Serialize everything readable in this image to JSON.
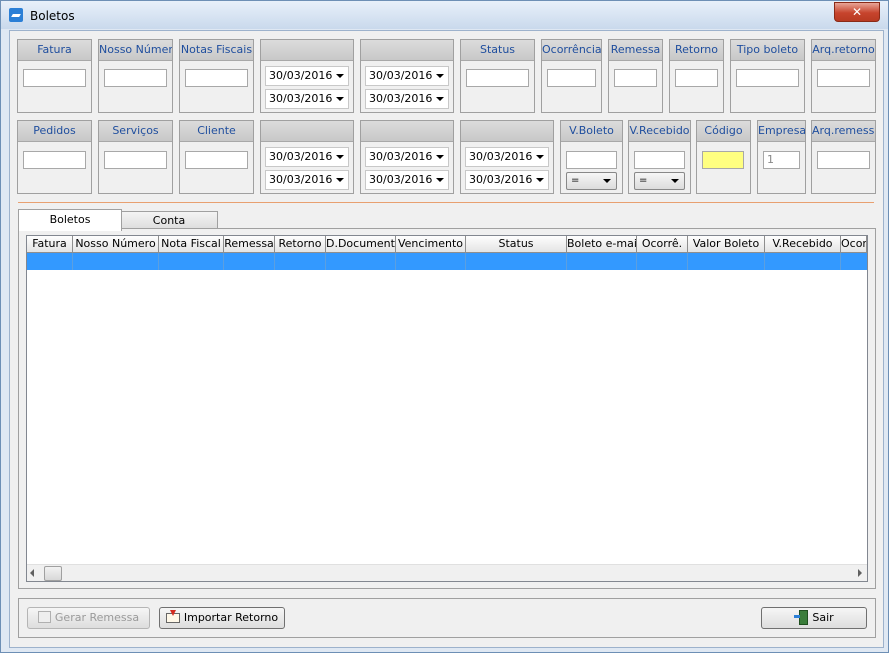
{
  "window": {
    "title": "Boletos",
    "close_label": "✕"
  },
  "filters_row1": {
    "fatura": {
      "label": "Fatura",
      "value": ""
    },
    "nosso_numero": {
      "label": "Nosso Número",
      "value": ""
    },
    "notas_fiscais": {
      "label": "Notas Fiscais",
      "value": ""
    },
    "date_group_1": {
      "label": "",
      "from": "30/03/2016",
      "to": "30/03/2016"
    },
    "date_group_2": {
      "label": "",
      "from": "30/03/2016",
      "to": "30/03/2016"
    },
    "status": {
      "label": "Status",
      "value": ""
    },
    "ocorrencia": {
      "label": "Ocorrência",
      "value": ""
    },
    "remessa": {
      "label": "Remessa",
      "value": ""
    },
    "retorno": {
      "label": "Retorno",
      "value": ""
    },
    "tipo_boleto": {
      "label": "Tipo boleto",
      "value": ""
    },
    "arq_retorno": {
      "label": "Arq.retorno",
      "value": ""
    }
  },
  "filters_row2": {
    "pedidos": {
      "label": "Pedidos",
      "value": ""
    },
    "servicos": {
      "label": "Serviços",
      "value": ""
    },
    "cliente": {
      "label": "Cliente",
      "value": ""
    },
    "date_group_3": {
      "label": "",
      "from": "30/03/2016",
      "to": "30/03/2016"
    },
    "date_group_4": {
      "label": "",
      "from": "30/03/2016",
      "to": "30/03/2016"
    },
    "date_group_5": {
      "label": "",
      "from": "30/03/2016",
      "to": "30/03/2016"
    },
    "v_boleto": {
      "label": "V.Boleto",
      "value": "",
      "operator": "="
    },
    "v_recebido": {
      "label": "V.Recebido",
      "value": "",
      "operator": "="
    },
    "codigo": {
      "label": "Código",
      "value": ""
    },
    "empresa": {
      "label": "Empresa",
      "value": "1"
    },
    "arq_remessa": {
      "label": "Arq.remessa",
      "value": ""
    }
  },
  "tabs": [
    {
      "label": "Boletos",
      "active": true
    },
    {
      "label": "Conta",
      "active": false
    }
  ],
  "grid": {
    "columns": [
      "Fatura",
      "Nosso Número",
      "Nota Fiscal",
      "Remessa",
      "Retorno",
      "D.Documento",
      "Vencimento",
      "Status",
      "Boleto e-mail",
      "Ocorrê.",
      "Valor Boleto",
      "V.Recebido",
      "Ocorr"
    ],
    "rows": [
      [
        "",
        "",
        "",
        "",
        "",
        "",
        "",
        "",
        "",
        "",
        "",
        "",
        ""
      ]
    ]
  },
  "buttons": {
    "gerar_remessa": "Gerar Remessa",
    "importar_retorno": "Importar Retorno",
    "sair": "Sair"
  },
  "colors": {
    "selection": "#3399ff",
    "header_text": "#1f4e9e",
    "close": "#c7442d"
  },
  "icons": {
    "app": "boleto-app-icon",
    "close": "close-icon",
    "gerar": "document-icon",
    "importar": "import-arrow-icon",
    "sair": "exit-door-icon"
  }
}
